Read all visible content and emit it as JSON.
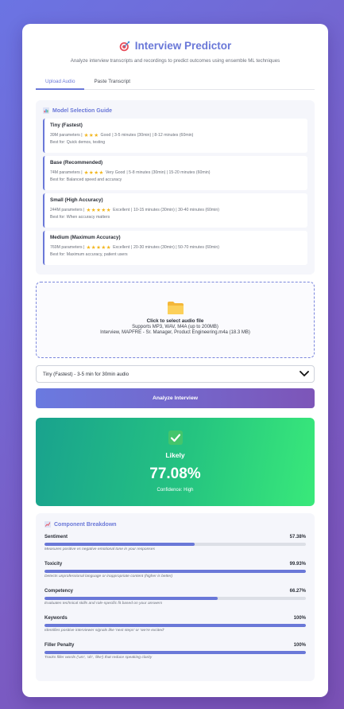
{
  "header": {
    "title": "Interview Predictor",
    "subtitle": "Analyze interview transcripts and recordings to predict outcomes using ensemble ML techniques",
    "icon": "target-icon"
  },
  "tabs": [
    {
      "label": "Upload Audio",
      "active": true
    },
    {
      "label": "Paste Transcript",
      "active": false
    }
  ],
  "guide": {
    "title": "Model Selection Guide",
    "models": [
      {
        "name": "Tiny (Fastest)",
        "params": "39M parameters |",
        "stars": "★★★",
        "rating": "Good",
        "timing": "| 3-5 minutes (30min) | 8-12 minutes (60min)",
        "best": "Best for: Quick demos, testing"
      },
      {
        "name": "Base (Recommended)",
        "params": "74M parameters |",
        "stars": "★★★★",
        "rating": "Very Good",
        "timing": "| 5-8 minutes (30min) | 15-20 minutes (60min)",
        "best": "Best for: Balanced speed and accuracy"
      },
      {
        "name": "Small (High Accuracy)",
        "params": "244M parameters |",
        "stars": "★★★★★",
        "rating": "Excellent",
        "timing": "| 10-15 minutes (30min) | 30-40 minutes (60min)",
        "best": "Best for: When accuracy matters"
      },
      {
        "name": "Medium (Maximum Accuracy)",
        "params": "769M parameters |",
        "stars": "★★★★★",
        "rating": "Excellent",
        "timing": "| 20-30 minutes (30min) | 50-70 minutes (60min)",
        "best": "Best for: Maximum accuracy, patient users"
      }
    ]
  },
  "upload": {
    "main": "Click to select audio file",
    "sub": "Supports MP3, WAV, M4A (up to 200MB)",
    "file": "Interview, MAPFRE - Sr. Manager, Product Engineering.m4a (18.3 MB)"
  },
  "select": {
    "value": "Tiny (Fastest) - 3-5 min for 30min audio"
  },
  "analyze_label": "Analyze Interview",
  "result": {
    "label": "Likely",
    "percent": "77.08%",
    "confidence": "Confidence: High"
  },
  "breakdown": {
    "title": "Component Breakdown",
    "metrics": [
      {
        "name": "Sentiment",
        "value": "57.38%",
        "fraction": 0.5738,
        "desc": "Measures positive vs negative emotional tone in your responses"
      },
      {
        "name": "Toxicity",
        "value": "99.93%",
        "fraction": 0.9993,
        "desc": "Detects unprofessional language or inappropriate content (higher is better)"
      },
      {
        "name": "Competency",
        "value": "66.27%",
        "fraction": 0.6627,
        "desc": "Evaluates technical skills and role-specific fit based on your answers"
      },
      {
        "name": "Keywords",
        "value": "100%",
        "fraction": 1.0,
        "desc": "Identifies positive interviewer signals like 'next steps' or 'we're excited'"
      },
      {
        "name": "Filler Penalty",
        "value": "100%",
        "fraction": 1.0,
        "desc": "Tracks filler words ('um', 'uh', 'like') that reduce speaking clarity"
      }
    ]
  },
  "colors": {
    "accent": "#6a78d8",
    "success_start": "#19a28e",
    "success_end": "#39e97a"
  }
}
